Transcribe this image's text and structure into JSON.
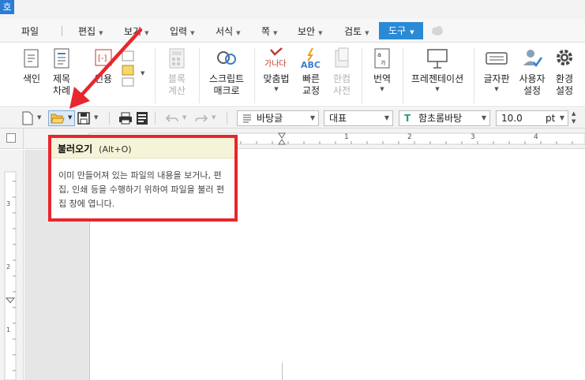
{
  "app": {
    "logo_glyph": "호"
  },
  "menubar": {
    "items": [
      {
        "label": "파일",
        "has_dropdown": false
      },
      {
        "label": "편집",
        "has_dropdown": true
      },
      {
        "label": "보기",
        "has_dropdown": true
      },
      {
        "label": "입력",
        "has_dropdown": true
      },
      {
        "label": "서식",
        "has_dropdown": true
      },
      {
        "label": "쪽",
        "has_dropdown": true
      },
      {
        "label": "보안",
        "has_dropdown": true
      },
      {
        "label": "검토",
        "has_dropdown": true
      }
    ],
    "active_tab": "도구",
    "dropdown_glyph": "▼"
  },
  "ribbon": {
    "index": {
      "line1": "색인",
      "line2": ""
    },
    "title": {
      "line1": "제목",
      "line2": "차례"
    },
    "cite": {
      "label": "인용"
    },
    "block_calc": {
      "line1": "블록",
      "line2": "계산"
    },
    "script": {
      "line1": "스크립트",
      "line2": "매크로"
    },
    "spell": {
      "label": "맞춤법",
      "icon_text": "가나다"
    },
    "quick": {
      "line1": "빠른",
      "line2": "교정",
      "icon_text": "ABC"
    },
    "hancom_dict": {
      "line1": "한컴",
      "line2": "사전"
    },
    "translate": {
      "label": "번역"
    },
    "present": {
      "label": "프레젠테이션"
    },
    "keyboard": {
      "label": "글자판"
    },
    "user_settings": {
      "line1": "사용자",
      "line2": "설정"
    },
    "env_settings": {
      "line1": "환경",
      "line2": "설정"
    }
  },
  "toolbar": {
    "style_value": "바탕글",
    "paragraph_value": "대표",
    "font_value": "함초롬바탕",
    "size_value": "10.0",
    "size_unit": "pt"
  },
  "ruler": {
    "h_labels": [
      "1",
      "2",
      "3",
      "4"
    ],
    "v_labels": [
      "3",
      "2",
      "1"
    ]
  },
  "tooltip": {
    "title": "불러오기",
    "shortcut": "(Alt+O)",
    "body": "이미 만들어져 있는 파일의 내용을 보거나, 편집, 인쇄 등을 수행하기 위하여 파일을 불러 편집 창에 엽니다."
  },
  "colors": {
    "accent": "#2a8ad4",
    "annotation_red": "#e8262d",
    "tooltip_head": "#f5f3d8"
  }
}
